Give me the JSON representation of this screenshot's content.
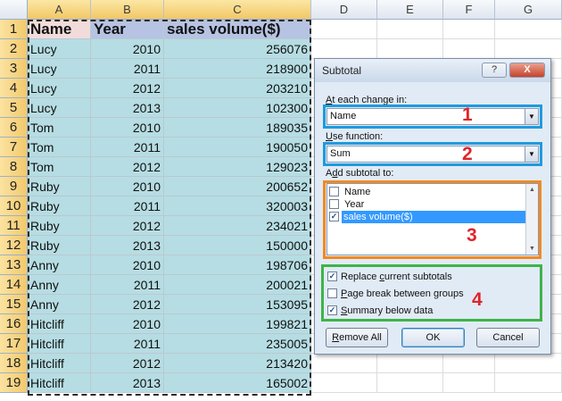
{
  "sheet": {
    "columns": [
      "A",
      "B",
      "C",
      "D",
      "E",
      "F",
      "G"
    ],
    "header_row": {
      "name": "Name",
      "year": "Year",
      "sales": "sales volume($)"
    },
    "rows": [
      {
        "num": "1"
      },
      {
        "num": "2",
        "name": "Lucy",
        "year": "2010",
        "sales": "256076"
      },
      {
        "num": "3",
        "name": "Lucy",
        "year": "2011",
        "sales": "218900"
      },
      {
        "num": "4",
        "name": "Lucy",
        "year": "2012",
        "sales": "203210"
      },
      {
        "num": "5",
        "name": "Lucy",
        "year": "2013",
        "sales": "102300"
      },
      {
        "num": "6",
        "name": "Tom",
        "year": "2010",
        "sales": "189035"
      },
      {
        "num": "7",
        "name": "Tom",
        "year": "2011",
        "sales": "190050"
      },
      {
        "num": "8",
        "name": "Tom",
        "year": "2012",
        "sales": "129023"
      },
      {
        "num": "9",
        "name": "Ruby",
        "year": "2010",
        "sales": "200652"
      },
      {
        "num": "10",
        "name": "Ruby",
        "year": "2011",
        "sales": "320003"
      },
      {
        "num": "11",
        "name": "Ruby",
        "year": "2012",
        "sales": "234021"
      },
      {
        "num": "12",
        "name": "Ruby",
        "year": "2013",
        "sales": "150000"
      },
      {
        "num": "13",
        "name": "Anny",
        "year": "2010",
        "sales": "198706"
      },
      {
        "num": "14",
        "name": "Anny",
        "year": "2011",
        "sales": "200021"
      },
      {
        "num": "15",
        "name": "Anny",
        "year": "2012",
        "sales": "153095"
      },
      {
        "num": "16",
        "name": "Hitcliff",
        "year": "2010",
        "sales": "199821"
      },
      {
        "num": "17",
        "name": "Hitcliff",
        "year": "2011",
        "sales": "235005"
      },
      {
        "num": "18",
        "name": "Hitcliff",
        "year": "2012",
        "sales": "213420"
      },
      {
        "num": "19",
        "name": "Hitcliff",
        "year": "2013",
        "sales": "165002"
      }
    ]
  },
  "dialog": {
    "title": "Subtotal",
    "help_glyph": "?",
    "close_glyph": "X",
    "change_label_accel": "A",
    "change_label_rest": "t each change in:",
    "change_value": "Name",
    "function_label_accel": "U",
    "function_label_rest": "se function:",
    "function_value": "Sum",
    "add_label_pre": "A",
    "add_label_accel": "d",
    "add_label_rest": "d subtotal to:",
    "list_items": [
      {
        "label": "Name",
        "checked": false
      },
      {
        "label": "Year",
        "checked": false
      },
      {
        "label": "sales volume($)",
        "checked": true
      }
    ],
    "options": [
      {
        "pre": "Replace ",
        "accel": "c",
        "rest": "urrent subtotals",
        "checked": true
      },
      {
        "pre": "",
        "accel": "P",
        "rest": "age break between groups",
        "checked": false
      },
      {
        "pre": "",
        "accel": "S",
        "rest": "ummary below data",
        "checked": true
      }
    ],
    "remove_all_pre": "",
    "remove_all_accel": "R",
    "remove_all_rest": "emove All",
    "ok_label": "OK",
    "cancel_label": "Cancel",
    "check_glyph": "✓",
    "arrow_glyph": "▼",
    "scroll_up_glyph": "▲",
    "scroll_down_glyph": "▼"
  },
  "annotations": [
    "1",
    "2",
    "3",
    "4"
  ],
  "colors": {
    "data_fill": "#b6dde3",
    "header_name_fill": "#f2dcdb",
    "header_year_sales_fill": "#b7c3e2",
    "callout_blue": "#1f9bde",
    "callout_orange": "#f08a24",
    "callout_green": "#3fb34a",
    "callout_number": "#e0242b"
  }
}
